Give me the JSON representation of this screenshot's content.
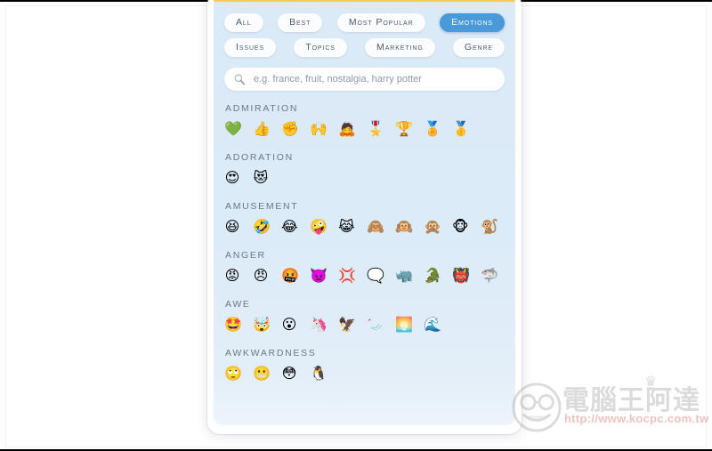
{
  "card": {
    "accent_color": "#ffc94d",
    "panel_color": "#dbeaf7"
  },
  "filters": {
    "active_color": "#4a99d8",
    "rows": [
      [
        {
          "label": "All",
          "active": false
        },
        {
          "label": "Best",
          "active": false
        },
        {
          "label": "Most Popular",
          "active": false
        },
        {
          "label": "Emotions",
          "active": true
        }
      ],
      [
        {
          "label": "Issues",
          "active": false
        },
        {
          "label": "Topics",
          "active": false
        },
        {
          "label": "Marketing",
          "active": false
        },
        {
          "label": "Genre",
          "active": false
        }
      ]
    ]
  },
  "search": {
    "icon": "search-icon",
    "value": "",
    "placeholder": "e.g. france, fruit, nostalgia, harry potter"
  },
  "sections": [
    {
      "title": "Admiration",
      "emojis": [
        {
          "char": "💚",
          "name": "green-heart"
        },
        {
          "char": "👍",
          "name": "thumbs-up"
        },
        {
          "char": "✊",
          "name": "raised-fist"
        },
        {
          "char": "🙌",
          "name": "raising-hands"
        },
        {
          "char": "🙇",
          "name": "person-bowing"
        },
        {
          "char": "🎖️",
          "name": "military-medal"
        },
        {
          "char": "🏆",
          "name": "trophy"
        },
        {
          "char": "🏅",
          "name": "sports-medal"
        },
        {
          "char": "🥇",
          "name": "first-place-medal"
        }
      ]
    },
    {
      "title": "Adoration",
      "emojis": [
        {
          "char": "😍",
          "name": "smiling-face-with-heart-eyes"
        },
        {
          "char": "😻",
          "name": "smiling-cat-with-heart-eyes"
        }
      ]
    },
    {
      "title": "Amusement",
      "emojis": [
        {
          "char": "😆",
          "name": "grinning-squinting-face"
        },
        {
          "char": "🤣",
          "name": "rolling-on-the-floor-laughing"
        },
        {
          "char": "😂",
          "name": "face-with-tears-of-joy"
        },
        {
          "char": "🤪",
          "name": "zany-face"
        },
        {
          "char": "😹",
          "name": "cat-with-tears-of-joy"
        },
        {
          "char": "🙈",
          "name": "see-no-evil-monkey"
        },
        {
          "char": "🙉",
          "name": "hear-no-evil-monkey"
        },
        {
          "char": "🙊",
          "name": "speak-no-evil-monkey"
        },
        {
          "char": "🐵",
          "name": "monkey-face"
        },
        {
          "char": "🐒",
          "name": "monkey"
        }
      ]
    },
    {
      "title": "Anger",
      "emojis": [
        {
          "char": "😡",
          "name": "pouting-face"
        },
        {
          "char": "😠",
          "name": "angry-face"
        },
        {
          "char": "🤬",
          "name": "face-with-symbols-on-mouth"
        },
        {
          "char": "👿",
          "name": "angry-face-with-horns"
        },
        {
          "char": "💢",
          "name": "anger-symbol"
        },
        {
          "char": "🗨️",
          "name": "right-anger-bubble"
        },
        {
          "char": "🦏",
          "name": "rhinoceros"
        },
        {
          "char": "🐊",
          "name": "crocodile"
        },
        {
          "char": "👹",
          "name": "ogre"
        },
        {
          "char": "🦈",
          "name": "shark"
        }
      ]
    },
    {
      "title": "Awe",
      "emojis": [
        {
          "char": "🤩",
          "name": "star-struck"
        },
        {
          "char": "🤯",
          "name": "exploding-head"
        },
        {
          "char": "😮",
          "name": "face-with-open-mouth"
        },
        {
          "char": "🦄",
          "name": "unicorn"
        },
        {
          "char": "🦅",
          "name": "eagle"
        },
        {
          "char": "🦢",
          "name": "swan"
        },
        {
          "char": "🌅",
          "name": "sunrise"
        },
        {
          "char": "🌊",
          "name": "water-wave"
        }
      ]
    },
    {
      "title": "Awkwardness",
      "emojis": [
        {
          "char": "🙄",
          "name": "face-with-rolling-eyes"
        },
        {
          "char": "😬",
          "name": "grimacing-face"
        },
        {
          "char": "😳",
          "name": "flushed-face"
        },
        {
          "char": "🐧",
          "name": "penguin"
        }
      ]
    }
  ],
  "watermark": {
    "brand": "電腦王阿達",
    "url": "http://www.kocpc.com.tw",
    "crown": "♛"
  }
}
